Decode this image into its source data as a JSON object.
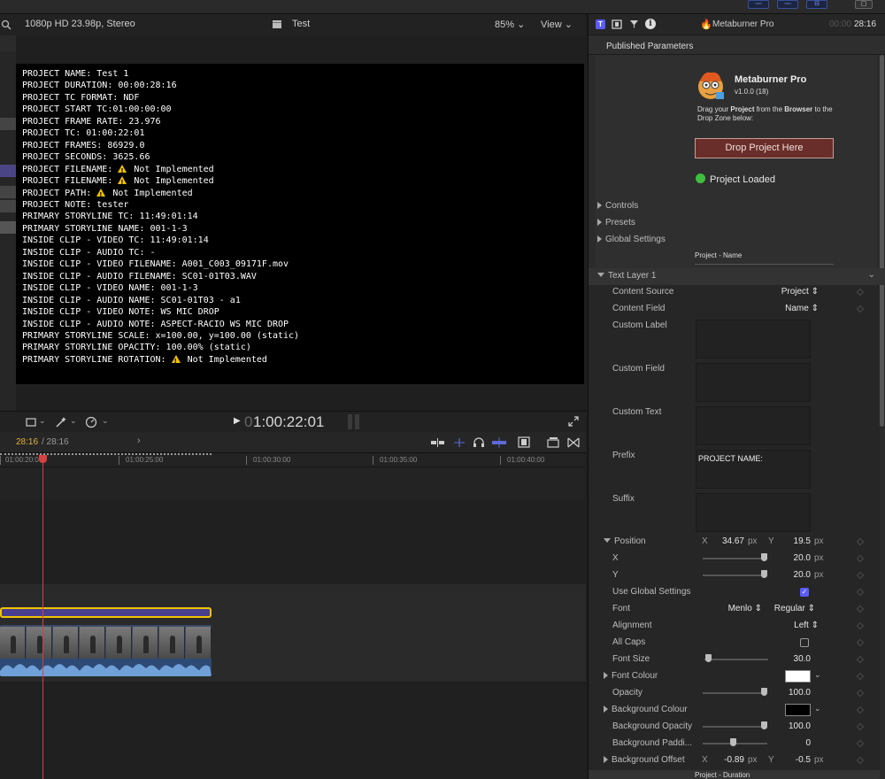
{
  "topbar": {
    "btn1": "▫▫▫",
    "btn2": "▫▫▫",
    "btn3": "⊟",
    "btn4": "▢"
  },
  "viewer": {
    "format": "1080p HD 23.98p, Stereo",
    "title": "Test",
    "zoom": "85%",
    "view_menu": "View",
    "timecode": "1:00:22:01",
    "timecode_dim": "0",
    "overlay_lines": [
      {
        "text": "PROJECT NAME: Test 1"
      },
      {
        "text": "PROJECT DURATION: 00:00:28:16"
      },
      {
        "text": "PROJECT TC FORMAT: NDF"
      },
      {
        "text": "PROJECT START TC:01:00:00:00"
      },
      {
        "text": "PROJECT FRAME RATE: 23.976"
      },
      {
        "text": "PROJECT TC: 01:00:22:01"
      },
      {
        "text": "PROJECT FRAMES: 86929.0"
      },
      {
        "text": "PROJECT SECONDS: 3625.66"
      },
      {
        "text": "PROJECT FILENAME: ",
        "warn": "Not Implemented"
      },
      {
        "text": "PROJECT FILENAME: ",
        "warn": "Not Implemented"
      },
      {
        "text": "PROJECT PATH: ",
        "warn": "Not Implemented"
      },
      {
        "text": "PROJECT NOTE: tester"
      },
      {
        "text": "PRIMARY STORYLINE TC: 11:49:01:14"
      },
      {
        "text": "PRIMARY STORYLINE NAME: 001-1-3"
      },
      {
        "text": "INSIDE CLIP - VIDEO TC: 11:49:01:14"
      },
      {
        "text": "INSIDE CLIP - AUDIO TC: -"
      },
      {
        "text": "INSIDE CLIP - VIDEO FILENAME: A001_C003_09171F.mov"
      },
      {
        "text": "INSIDE CLIP - AUDIO FILENAME: SC01-01T03.WAV"
      },
      {
        "text": "INSIDE CLIP - VIDEO NAME: 001-1-3"
      },
      {
        "text": "INSIDE CLIP - AUDIO NAME: SC01-01T03 - a1"
      },
      {
        "text": "INSIDE CLIP - VIDEO NOTE: WS MIC DROP"
      },
      {
        "text": "INSIDE CLIP - AUDIO NOTE: ASPECT-RACIO WS MIC DROP"
      },
      {
        "text": "PRIMARY STORYLINE SCALE: x=100.00, y=100.00 (static)"
      },
      {
        "text": "PRIMARY STORYLINE OPACITY: 100.00% (static)"
      },
      {
        "text": "PRIMARY STORYLINE ROTATION: ",
        "warn": "Not Implemented"
      }
    ]
  },
  "timeline": {
    "position": "28:16",
    "duration": "/ 28:16",
    "ruler": [
      "01:00:20:00",
      "01:00:25:00",
      "01:00:30:00",
      "01:00:35:00",
      "01:00:40:00"
    ]
  },
  "inspector": {
    "plugin_title": "Metaburner Pro",
    "time_dim": "00:00",
    "time": "28:16",
    "section": "Published Parameters",
    "app_name": "Metaburner Pro",
    "version": "v1.0.0 (18)",
    "instructions_1": "Drag your ",
    "instructions_bold1": "Project",
    "instructions_2": " from the ",
    "instructions_bold2": "Browser",
    "instructions_3": " to the Drop Zone below:",
    "drop_button": "Drop Project Here",
    "status": "Project Loaded",
    "groups": [
      "Controls",
      "Presets",
      "Global Settings"
    ],
    "divider_label": "Project - Name",
    "layer": "Text Layer 1",
    "content_source_label": "Content Source",
    "content_source_value": "Project",
    "content_field_label": "Content Field",
    "content_field_value": "Name",
    "custom_label": "Custom Label",
    "custom_field": "Custom Field",
    "custom_text": "Custom Text",
    "prefix_label": "Prefix",
    "prefix_value": "PROJECT NAME:",
    "suffix_label": "Suffix",
    "position_label": "Position",
    "pos_x_label": "X",
    "pos_x_value": "34.67",
    "pos_y_label": "Y",
    "pos_y_value": "19.5",
    "px": "px",
    "x_label": "X",
    "x_value": "20.0",
    "y_label": "Y",
    "y_value": "20.0",
    "use_global_label": "Use Global Settings",
    "font_label": "Font",
    "font_value": "Menlo",
    "font_style": "Regular",
    "alignment_label": "Alignment",
    "alignment_value": "Left",
    "allcaps_label": "All Caps",
    "fontsize_label": "Font Size",
    "fontsize_value": "30.0",
    "fontcolour_label": "Font Colour",
    "opacity_label": "Opacity",
    "opacity_value": "100.0",
    "bgcolour_label": "Background Colour",
    "bgopacity_label": "Background Opacity",
    "bgopacity_value": "100.0",
    "bgpadding_label": "Background Paddi...",
    "bgpadding_value": "0",
    "bgoffset_label": "Background Offset",
    "bgoffset_x": "-0.89",
    "bgoffset_y": "-0.5",
    "footer_label": "Project - Duration"
  },
  "colors": {
    "accent": "#5b5bff",
    "drop_button": "#6a2e2a",
    "status_green": "#3fbf3f",
    "clip_purple": "#4a3e8e",
    "clip_yellow": "#f0c400"
  }
}
